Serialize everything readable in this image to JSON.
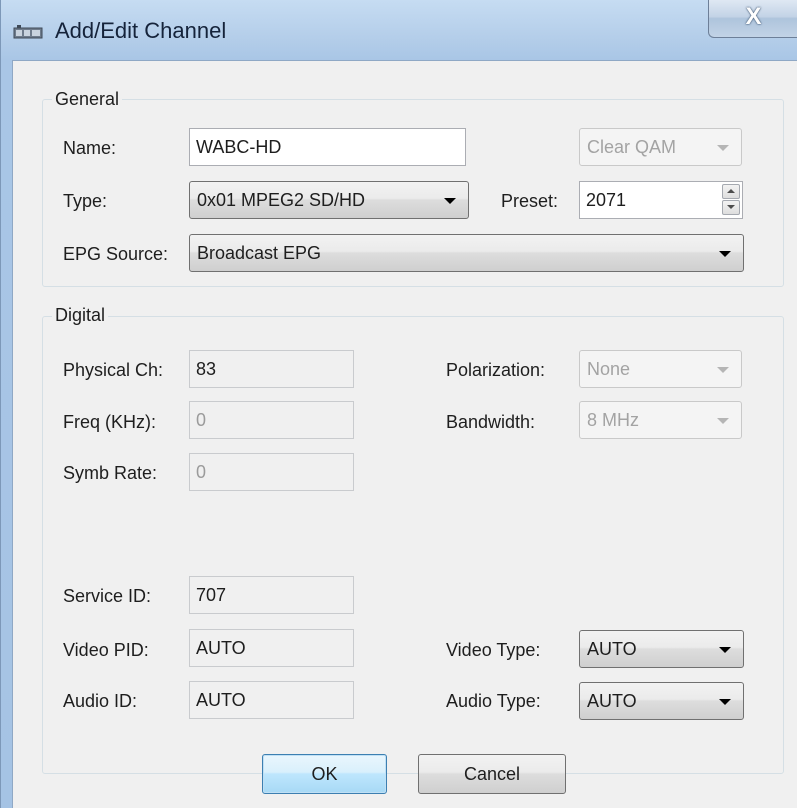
{
  "window": {
    "title": "Add/Edit Channel",
    "close_glyph": "X",
    "icon": "app-icon"
  },
  "general": {
    "legend": "General",
    "name_label": "Name:",
    "name_value": "WABC-HD",
    "modulation_value": "Clear QAM",
    "type_label": "Type:",
    "type_value": "0x01 MPEG2 SD/HD",
    "preset_label": "Preset:",
    "preset_value": "2071",
    "epg_label": "EPG Source:",
    "epg_value": "Broadcast EPG"
  },
  "digital": {
    "legend": "Digital",
    "physical_label": "Physical Ch:",
    "physical_value": "83",
    "freq_label": "Freq (KHz):",
    "freq_value": "0",
    "symb_label": "Symb Rate:",
    "symb_value": "0",
    "polarization_label": "Polarization:",
    "polarization_value": "None",
    "bandwidth_label": "Bandwidth:",
    "bandwidth_value": "8 MHz",
    "service_label": "Service ID:",
    "service_value": "707",
    "video_pid_label": "Video PID:",
    "video_pid_value": "AUTO",
    "audio_id_label": "Audio ID:",
    "audio_id_value": "AUTO",
    "video_type_label": "Video Type:",
    "video_type_value": "AUTO",
    "audio_type_label": "Audio Type:",
    "audio_type_value": "AUTO"
  },
  "buttons": {
    "ok": "OK",
    "cancel": "Cancel"
  },
  "colors": {
    "title_bar": "#b3cde9",
    "client_bg": "#f0f0f0",
    "default_button_border": "#3c7fb1"
  }
}
